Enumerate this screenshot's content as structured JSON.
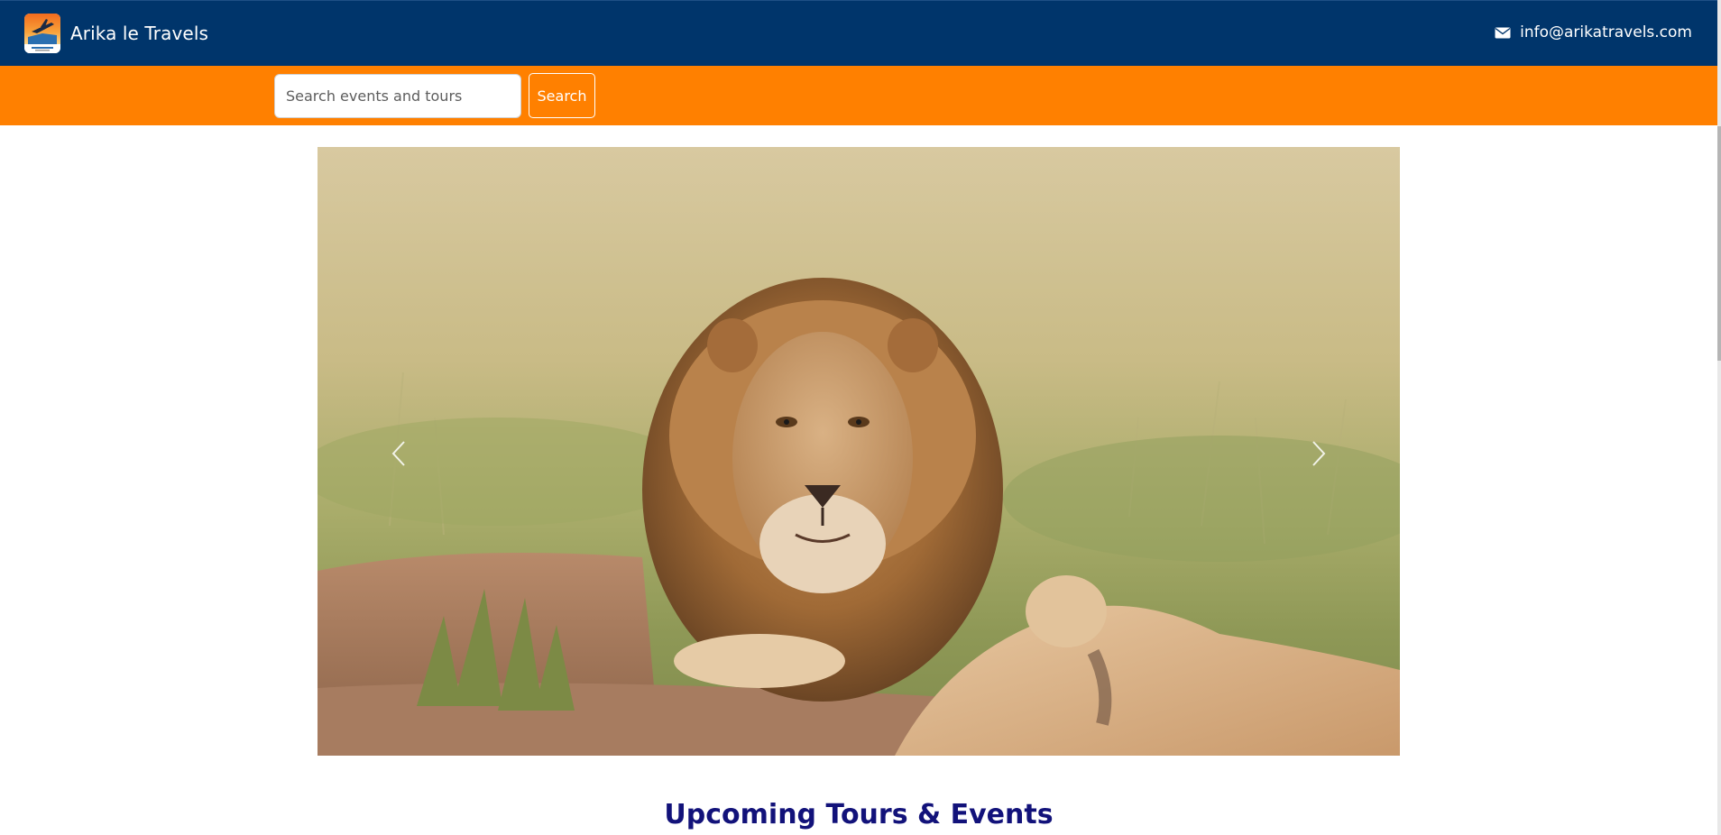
{
  "header": {
    "brand_name": "Arika le Travels",
    "logo_icon": "travel-logo-icon",
    "contact_email": "info@arikatravels.com",
    "mail_icon": "envelope-icon",
    "background_color": "#00356b"
  },
  "search": {
    "placeholder": "Search events and tours",
    "value": "",
    "button_label": "Search",
    "background_color": "#ff8000"
  },
  "carousel": {
    "image_description_icon": "lion-photo",
    "prev_icon": "chevron-left-icon",
    "next_icon": "chevron-right-icon"
  },
  "main": {
    "section_title": "Upcoming Tours & Events",
    "title_color": "#12127a"
  }
}
